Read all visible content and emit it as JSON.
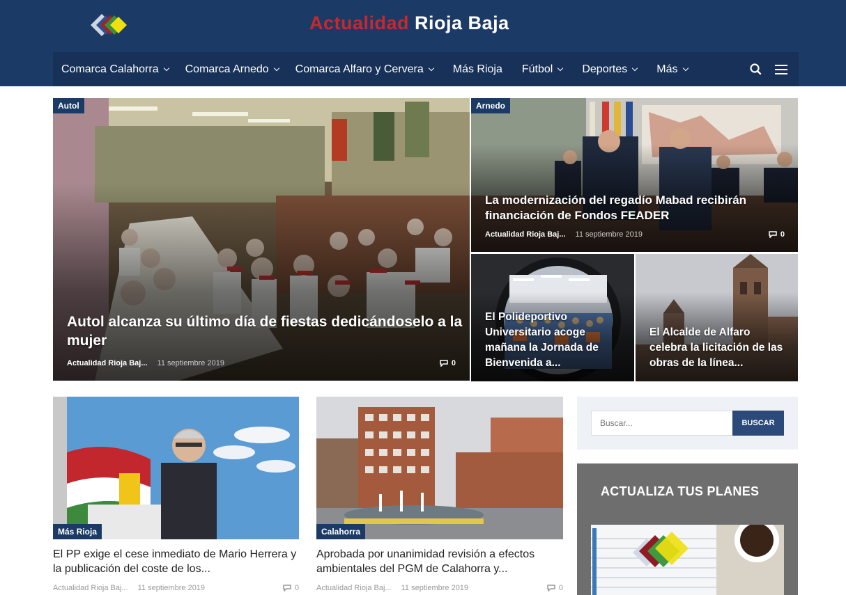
{
  "site": {
    "title_part1": "Actualidad",
    "title_part2": "Rioja Baja"
  },
  "nav": {
    "items": [
      {
        "label": "Comarca Calahorra",
        "dropdown": true
      },
      {
        "label": "Comarca Arnedo",
        "dropdown": true
      },
      {
        "label": "Comarca Alfaro y Cervera",
        "dropdown": true
      },
      {
        "label": "Más Rioja",
        "dropdown": false
      },
      {
        "label": "Fútbol",
        "dropdown": true
      },
      {
        "label": "Deportes",
        "dropdown": true
      },
      {
        "label": "Más",
        "dropdown": true
      }
    ],
    "icons": [
      "search-icon",
      "hamburger-menu-icon"
    ]
  },
  "hero": {
    "main": {
      "category": "Autol",
      "title": "Autol alcanza su último día de fiestas dedicándoselo a la mujer",
      "author": "Actualidad Rioja Baj...",
      "date": "11 septiembre 2019",
      "comments": "0"
    },
    "top_right": {
      "category": "Arnedo",
      "title": "La modernización del regadío Mabad recibirán financiación de Fondos FEADER",
      "author": "Actualidad Rioja Baj...",
      "date": "11 septiembre 2019",
      "comments": "0"
    },
    "bottom_left": {
      "title": "El Polideportivo Universitario acoge mañana la Jornada de Bienvenida a..."
    },
    "bottom_right": {
      "title": "El Alcalde de Alfaro celebra la licitación de las obras de la línea..."
    }
  },
  "cards": [
    {
      "category": "Más Rioja",
      "title": "El PP exige el cese inmediato de Mario Herrera y la publicación del coste de los...",
      "author": "Actualidad Rioja Baj...",
      "date": "11 septiembre 2019",
      "comments": "0"
    },
    {
      "category": "Calahorra",
      "title": "Aprobada por unanimidad revisión a efectos ambientales del PGM de Calahorra y...",
      "author": "Actualidad Rioja Baj...",
      "date": "11 septiembre 2019",
      "comments": "0"
    }
  ],
  "sidebar": {
    "search_placeholder": "Buscar...",
    "search_button": "BUSCAR",
    "plan_title": "ACTUALIZA TUS PLANES"
  },
  "colors": {
    "header_bg": "#1b3a66",
    "nav_bg": "#173158",
    "brand_red": "#c6282e",
    "button_blue": "#2b4a7a"
  }
}
